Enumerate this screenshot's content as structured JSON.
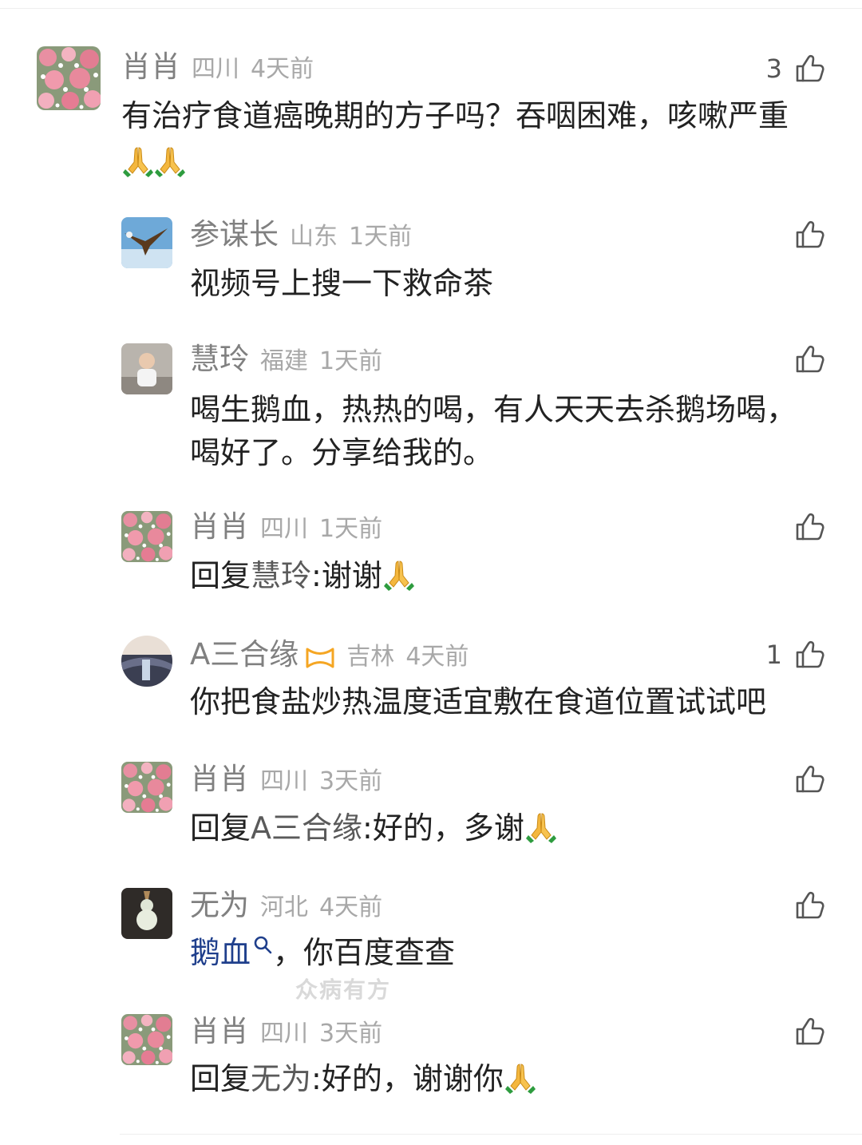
{
  "comments": [
    {
      "name": "肖肖",
      "location": "四川",
      "time": "4天前",
      "likes": "3",
      "text": "有治疗食道癌晚期的方子吗？吞咽困难，咳嗽严重",
      "emoji": "🙏🙏"
    },
    {
      "name": "参谋长",
      "location": "山东",
      "time": "1天前",
      "text": "视频号上搜一下救命茶"
    },
    {
      "name": "慧玲",
      "location": "福建",
      "time": "1天前",
      "text_line1": "喝生鹅血，热热的喝，有人天天去杀鹅场喝，",
      "text_line2": "喝好了。分享给我的。"
    },
    {
      "name": "肖肖",
      "location": "四川",
      "time": "1天前",
      "reply_prefix": "回复",
      "reply_to": "慧玲",
      "reply_text": ":谢谢",
      "emoji": "🙏"
    },
    {
      "name": "A三合缘",
      "location": "吉林",
      "time": "4天前",
      "likes": "1",
      "text": "你把食盐炒热温度适宜敷在食道位置试试吧",
      "badge": "vip-badge-icon"
    },
    {
      "name": "肖肖",
      "location": "四川",
      "time": "3天前",
      "reply_prefix": "回复",
      "reply_to": "A三合缘",
      "reply_text": ":好的，多谢",
      "emoji": "🙏"
    },
    {
      "name": "无为",
      "location": "河北",
      "time": "4天前",
      "link_text": "鹅血",
      "text": "，你百度查查"
    },
    {
      "name": "肖肖",
      "location": "四川",
      "time": "3天前",
      "reply_prefix": "回复",
      "reply_to": "无为",
      "reply_text": ":好的，谢谢你",
      "emoji": "🙏"
    }
  ],
  "watermark": "众病有方",
  "icons": {
    "like": "thumbs-up-icon",
    "search": "search-icon",
    "pray": "folded-hands-emoji"
  },
  "colors": {
    "name": "#808080",
    "meta": "#a8a8a8",
    "text": "#222222",
    "link": "#1f3f8c",
    "badge": "#f5a623"
  }
}
